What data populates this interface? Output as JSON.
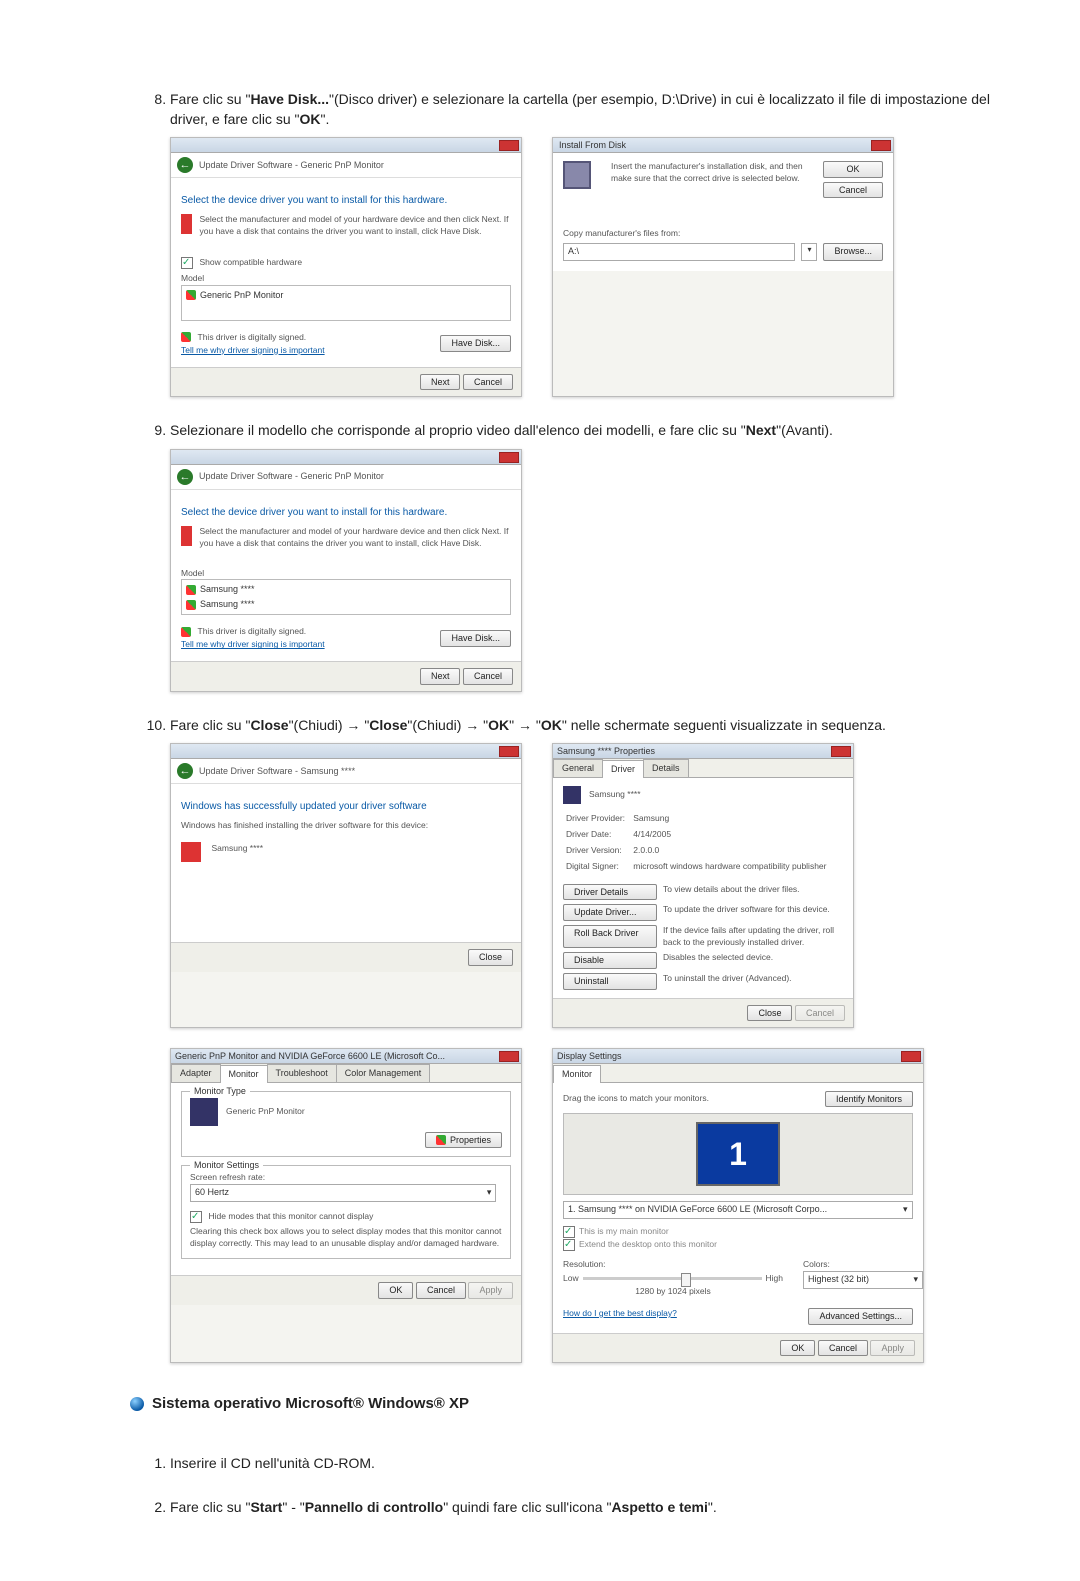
{
  "step8": {
    "num": "8.",
    "text_before": "Fare clic su \"",
    "have_disk": "Have Disk...",
    "text_mid": "\"(Disco driver) e selezionare la cartella (per esempio, D:\\Drive) in cui è localizzato il file di impostazione del driver, e fare clic su \"",
    "ok": "OK",
    "text_after": "\"."
  },
  "dlg_update_a": {
    "crumb": "Update Driver Software - Generic PnP Monitor",
    "heading": "Select the device driver you want to install for this hardware.",
    "sub": "Select the manufacturer and model of your hardware device and then click Next. If you have a disk that contains the driver you want to install, click Have Disk.",
    "compat": "Show compatible hardware",
    "model_label": "Model",
    "model_item": "Generic PnP Monitor",
    "signed": "This driver is digitally signed.",
    "signing_link": "Tell me why driver signing is important",
    "have_disk_btn": "Have Disk...",
    "next": "Next",
    "cancel": "Cancel"
  },
  "dlg_install_from_disk": {
    "title": "Install From Disk",
    "instr": "Insert the manufacturer's installation disk, and then make sure that the correct drive is selected below.",
    "ok": "OK",
    "cancel": "Cancel",
    "copy_from": "Copy manufacturer's files from:",
    "path": "A:\\",
    "browse": "Browse..."
  },
  "step9": {
    "text_before": "Selezionare il modello che corrisponde al proprio video dall'elenco dei modelli, e fare clic su \"",
    "next": "Next",
    "text_after": "\"(Avanti)."
  },
  "dlg_update_b": {
    "crumb": "Update Driver Software - Generic PnP Monitor",
    "heading": "Select the device driver you want to install for this hardware.",
    "sub": "Select the manufacturer and model of your hardware device and then click Next. If you have a disk that contains the driver you want to install, click Have Disk.",
    "model_label": "Model",
    "item1": "Samsung ****",
    "item2": "Samsung ****",
    "signed": "This driver is digitally signed.",
    "signing_link": "Tell me why driver signing is important",
    "have_disk_btn": "Have Disk...",
    "next": "Next",
    "cancel": "Cancel"
  },
  "step10": {
    "text_before": "Fare clic su \"",
    "close1": "Close",
    "mid1": "\"(Chiudi) → \"",
    "close2": "Close",
    "mid2": "\"(Chiudi) → \"",
    "ok1": "OK",
    "mid3": "\" → \"",
    "ok2": "OK",
    "text_after": "\" nelle schermate seguenti visualizzate in sequenza."
  },
  "dlg_success": {
    "crumb": "Update Driver Software - Samsung ****",
    "heading": "Windows has successfully updated your driver software",
    "sub": "Windows has finished installing the driver software for this device:",
    "device": "Samsung ****",
    "close": "Close"
  },
  "dlg_props": {
    "title": "Samsung **** Properties",
    "tab_general": "General",
    "tab_driver": "Driver",
    "tab_details": "Details",
    "device": "Samsung ****",
    "provider_l": "Driver Provider:",
    "provider_v": "Samsung",
    "date_l": "Driver Date:",
    "date_v": "4/14/2005",
    "ver_l": "Driver Version:",
    "ver_v": "2.0.0.0",
    "signer_l": "Digital Signer:",
    "signer_v": "microsoft windows hardware compatibility publisher",
    "btn_details": "Driver Details",
    "txt_details": "To view details about the driver files.",
    "btn_update": "Update Driver...",
    "txt_update": "To update the driver software for this device.",
    "btn_rollback": "Roll Back Driver",
    "txt_rollback": "If the device fails after updating the driver, roll back to the previously installed driver.",
    "btn_disable": "Disable",
    "txt_disable": "Disables the selected device.",
    "btn_uninstall": "Uninstall",
    "txt_uninstall": "To uninstall the driver (Advanced).",
    "close": "Close",
    "cancel": "Cancel"
  },
  "dlg_monitor": {
    "title": "Generic PnP Monitor and NVIDIA GeForce 6600 LE (Microsoft Co...",
    "tab_adapter": "Adapter",
    "tab_monitor": "Monitor",
    "tab_trouble": "Troubleshoot",
    "tab_color": "Color Management",
    "gb_type": "Monitor Type",
    "mon_name": "Generic PnP Monitor",
    "properties": "Properties",
    "gb_settings": "Monitor Settings",
    "refresh_l": "Screen refresh rate:",
    "refresh_v": "60 Hertz",
    "hide_check": "Hide modes that this monitor cannot display",
    "hide_txt": "Clearing this check box allows you to select display modes that this monitor cannot display correctly. This may lead to an unusable display and/or damaged hardware.",
    "ok": "OK",
    "cancel": "Cancel",
    "apply": "Apply"
  },
  "dlg_display": {
    "title": "Display Settings",
    "tab": "Monitor",
    "drag": "Drag the icons to match your monitors.",
    "identify": "Identify Monitors",
    "dropdown": "1. Samsung **** on NVIDIA GeForce 6600 LE (Microsoft Corpo...",
    "main_chk": "This is my main monitor",
    "extend_chk": "Extend the desktop onto this monitor",
    "res_l": "Resolution:",
    "low": "Low",
    "high": "High",
    "res_v": "1280 by 1024 pixels",
    "colors_l": "Colors:",
    "colors_v": "Highest (32 bit)",
    "help_link": "How do I get the best display?",
    "adv": "Advanced Settings...",
    "ok": "OK",
    "cancel": "Cancel",
    "apply": "Apply"
  },
  "xp_heading": "Sistema operativo Microsoft® Windows® XP",
  "xp_list": {
    "item1": "Inserire il CD nell'unità CD-ROM.",
    "item2_a": "Fare clic su \"",
    "start": "Start",
    "item2_b": "\" - \"",
    "panel": "Pannello di controllo",
    "item2_c": "\" quindi fare clic sull'icona \"",
    "theme": "Aspetto e temi",
    "item2_d": "\"."
  }
}
